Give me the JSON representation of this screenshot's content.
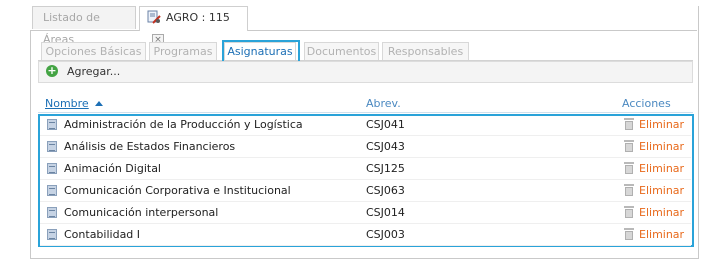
{
  "top_tabs": [
    {
      "label": "Listado de Áreas"
    },
    {
      "label": "AGRO : 115",
      "close_glyph": "×"
    }
  ],
  "inner_tabs": [
    {
      "label": "Opciones Básicas"
    },
    {
      "label": "Programas"
    },
    {
      "label": "Asignaturas",
      "active": true
    },
    {
      "label": "Documentos"
    },
    {
      "label": "Responsables"
    }
  ],
  "toolbar": {
    "add_label": "Agregar...",
    "add_glyph": "+"
  },
  "grid": {
    "columns": {
      "name": "Nombre",
      "abrev": "Abrev.",
      "actions": "Acciones"
    },
    "rows": [
      {
        "name": "Administración de la Producción y Logística",
        "abrev": "CSJ041",
        "action": "Eliminar"
      },
      {
        "name": "Análisis de Estados Financieros",
        "abrev": "CSJ043",
        "action": "Eliminar"
      },
      {
        "name": "Animación Digital",
        "abrev": "CSJ125",
        "action": "Eliminar"
      },
      {
        "name": "Comunicación Corporativa e Institucional",
        "abrev": "CSJ063",
        "action": "Eliminar"
      },
      {
        "name": "Comunicación interpersonal",
        "abrev": "CSJ014",
        "action": "Eliminar"
      },
      {
        "name": "Contabilidad I",
        "abrev": "CSJ003",
        "action": "Eliminar"
      }
    ]
  },
  "icons": {
    "tab": "document-settings-icon",
    "add": "plus-circle-icon",
    "row": "document-icon",
    "delete": "trash-icon",
    "sort": "sort-ascending-icon"
  },
  "colors": {
    "highlight": "#2aa3d9",
    "link": "#1c6fb5",
    "delete": "#e86a1c",
    "add": "#44a444"
  }
}
